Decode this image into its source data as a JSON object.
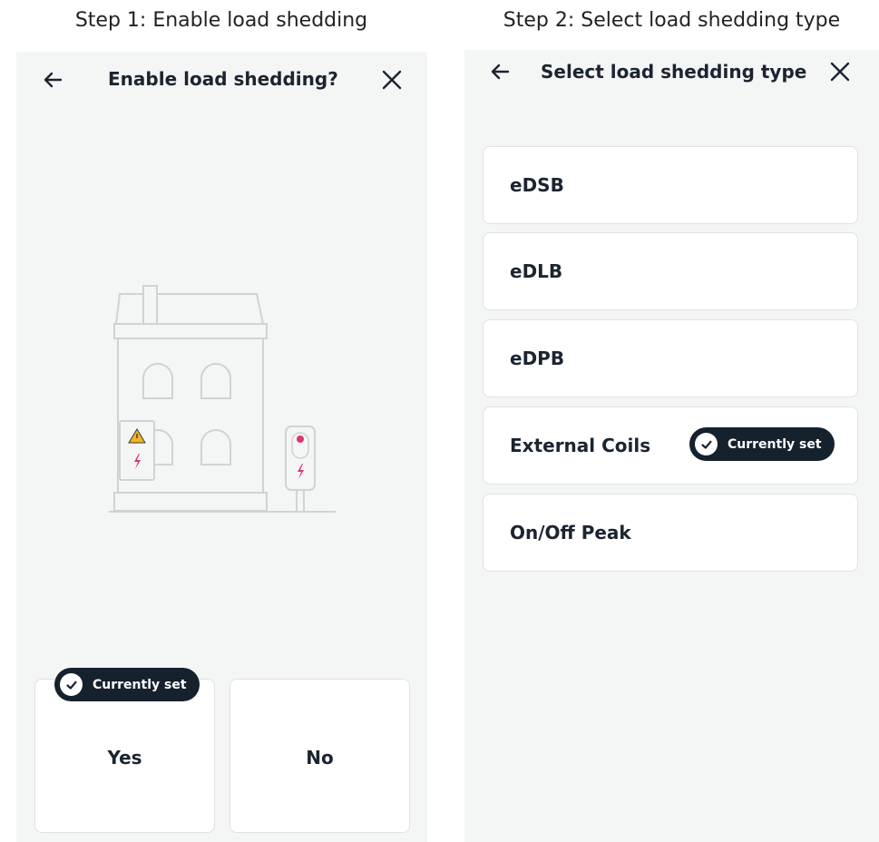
{
  "captions": {
    "step1": "Step 1: Enable load shedding",
    "step2": "Step 2: Select load shedding type"
  },
  "screen1": {
    "title": "Enable load shedding?",
    "choices": [
      {
        "label": "Yes",
        "currently_set": true
      },
      {
        "label": "No",
        "currently_set": false
      }
    ],
    "badge_label": "Currently set"
  },
  "screen2": {
    "title": "Select load shedding type",
    "options": [
      {
        "label": "eDSB",
        "currently_set": false
      },
      {
        "label": "eDLB",
        "currently_set": false
      },
      {
        "label": "eDPB",
        "currently_set": false
      },
      {
        "label": "External Coils",
        "currently_set": true
      },
      {
        "label": "On/Off Peak",
        "currently_set": false
      }
    ],
    "badge_label": "Currently set"
  },
  "icons": {
    "back": "arrow-left-icon",
    "close": "close-icon",
    "check": "check-circle-icon",
    "house": "house-illustration",
    "warning": "warning-triangle-icon",
    "bolt": "lightning-bolt-icon",
    "charger": "ev-charger-icon"
  },
  "colors": {
    "screen_background": "#f4f5f5",
    "card_background": "#ffffff",
    "badge_background": "#16212e",
    "text_primary": "#1b2430",
    "accent_bolt": "#e0356b",
    "warning_yellow": "#f2b51d"
  }
}
